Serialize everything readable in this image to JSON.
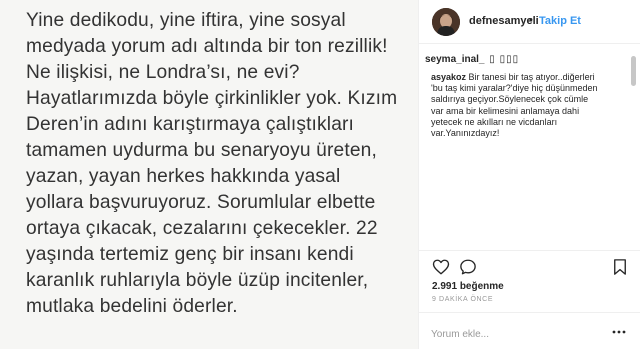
{
  "image_text": {
    "lines": [
      "Yine dedikodu, yine iftira, yine sosyal",
      "medyada yorum adı altında bir ton rezillik!",
      "Ne ilişkisi, ne Londra’sı, ne evi?",
      "Hayatlarımızda böyle çirkinlikler yok. Kızım",
      "Deren’in adını karıştırmaya çalıştıkları",
      "tamamen uydurma bu senaryoyu üreten,",
      "yazan, yayan herkes hakkında yasal",
      "yollara başvuruyoruz. Sorumlular elbette",
      "ortaya çıkacak, cezalarını çekecekler. 22",
      "yaşında tertemiz genç bir insanı kendi",
      "karanlık ruhlarıyla böyle üzüp incitenler,",
      "mutlaka bedelini öderler."
    ]
  },
  "header": {
    "username": "defnesamyeli",
    "separator": "•",
    "follow_label": "Takip Et"
  },
  "comments": {
    "first": {
      "username": "seyma_inal_",
      "text": "▯ ▯▯▯"
    },
    "second": {
      "username": "asyakoz",
      "line1": "Bir tanesi bir taş atıyor..diğerleri",
      "line2": "'bu taş kimi yaralar?'diye hiç düşünmeden",
      "line3": "saldırıya geçiyor.Söylenecek çok cümle",
      "line4": "var ama bir kelimesini anlamaya dahi",
      "line5": "yetecek ne akılları ne vicdanları",
      "line6": "var.Yanınızdayız!"
    }
  },
  "actions": {
    "icons": [
      "heart-icon",
      "comment-icon",
      "bookmark-icon"
    ]
  },
  "likes": {
    "count": "2.991",
    "label": "beğenme"
  },
  "timestamp": "9 DAKİKA ÖNCE",
  "comment_box": {
    "placeholder": "Yorum ekle...",
    "more_icon": "more-icon"
  },
  "colors": {
    "link_blue": "#3897f0",
    "text": "#262626",
    "muted": "#999999",
    "image_background": "#f6f6f4"
  }
}
